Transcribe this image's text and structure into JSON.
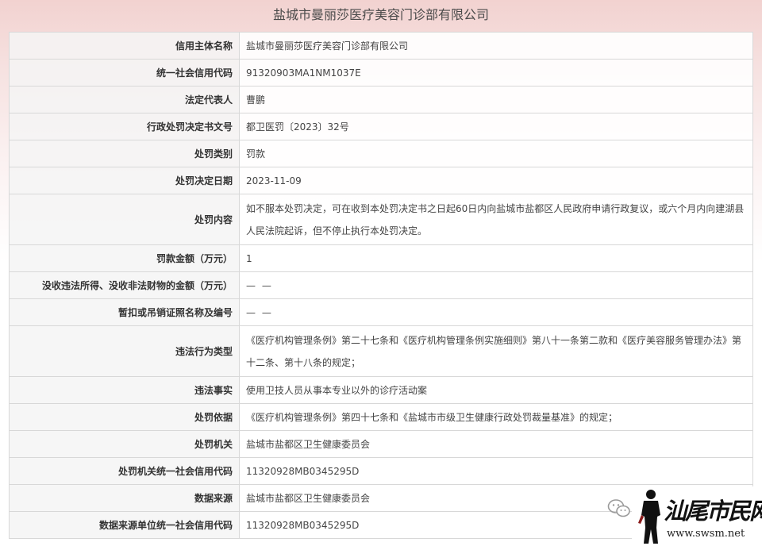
{
  "page_title": "盐城市曼丽莎医疗美容门诊部有限公司",
  "rows": [
    {
      "label": "信用主体名称",
      "value": "盐城市曼丽莎医疗美容门诊部有限公司"
    },
    {
      "label": "统一社会信用代码",
      "value": "91320903MA1NM1037E"
    },
    {
      "label": "法定代表人",
      "value": "曹鹏"
    },
    {
      "label": "行政处罚决定书文号",
      "value": "都卫医罚〔2023〕32号"
    },
    {
      "label": "处罚类别",
      "value": "罚款"
    },
    {
      "label": "处罚决定日期",
      "value": "2023-11-09"
    },
    {
      "label": "处罚内容",
      "value": "如不服本处罚决定，可在收到本处罚决定书之日起60日内向盐城市盐都区人民政府申请行政复议，或六个月内向建湖县人民法院起诉，但不停止执行本处罚决定。"
    },
    {
      "label": "罚款金额（万元）",
      "value": "1"
    },
    {
      "label": "没收违法所得、没收非法财物的金额（万元）",
      "value": "— —"
    },
    {
      "label": "暂扣或吊销证照名称及编号",
      "value": "— —"
    },
    {
      "label": "违法行为类型",
      "value": "《医疗机构管理条例》第二十七条和《医疗机构管理条例实施细则》第八十一条第二款和《医疗美容服务管理办法》第十二条、第十八条的规定；"
    },
    {
      "label": "违法事实",
      "value": "使用卫技人员从事本专业以外的诊疗活动案"
    },
    {
      "label": "处罚依据",
      "value": "《医疗机构管理条例》第四十七条和《盐城市市级卫生健康行政处罚裁量基准》的规定；"
    },
    {
      "label": "处罚机关",
      "value": "盐城市盐都区卫生健康委员会"
    },
    {
      "label": "处罚机关统一社会信用代码",
      "value": "11320928MB0345295D"
    },
    {
      "label": "数据来源",
      "value": "盐城市盐都区卫生健康委员会"
    },
    {
      "label": "数据来源单位统一社会信用代码",
      "value": "11320928MB0345295D"
    }
  ],
  "watermark": {
    "icon": "wechat-icon",
    "brand": "汕尾市民网",
    "url": "www.swsm.net"
  }
}
